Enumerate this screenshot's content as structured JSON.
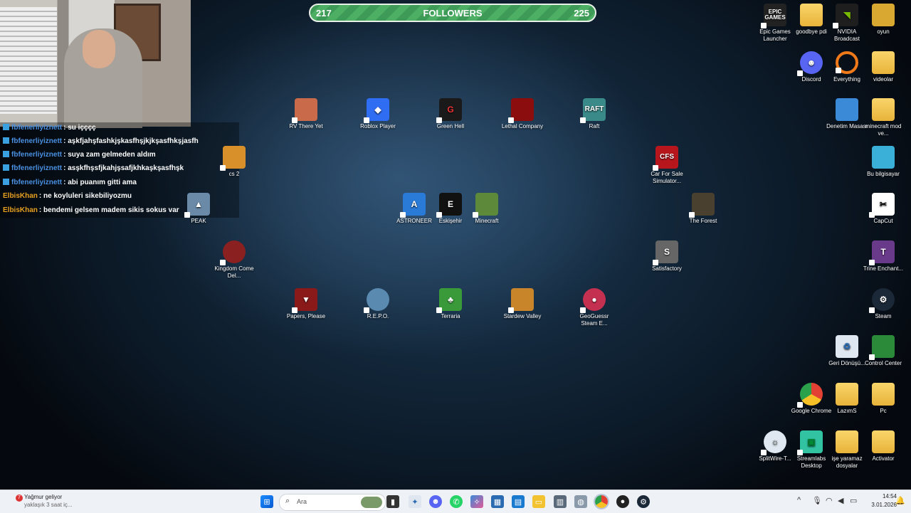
{
  "followers": {
    "current": "217",
    "label": "FOLLOWERS",
    "goal": "225",
    "progress_fraction": 0.96
  },
  "chat": [
    {
      "user": "fbfenerliyiznett",
      "text": ": su içççç",
      "color": "#4a90e2",
      "badge": true
    },
    {
      "user": "fbfenerliyiznett",
      "text": ": aşkfjahşfashkjşkasfhşjkjkşasfhkşjasfh",
      "color": "#4a90e2",
      "badge": true
    },
    {
      "user": "fbfenerliyiznett",
      "text": ": suya zam gelmeden aldım",
      "color": "#4a90e2",
      "badge": true
    },
    {
      "user": "fbfenerliyiznett",
      "text": ": asşkfhşsfjkahjşsafjkhkaşkşasfhşk",
      "color": "#4a90e2",
      "badge": true
    },
    {
      "user": "fbfenerliyiznett",
      "text": ": abi puanım gitti ama",
      "color": "#4a90e2",
      "badge": true
    },
    {
      "user": "ElbisKhan",
      "text": ": ne koyluleri sikebiliyozmu",
      "color": "#e8a020",
      "badge": false
    },
    {
      "user": "ElbisKhan",
      "text": ": bendemi gelsem madem sikis sokus var",
      "color": "#e8a020",
      "badge": false
    }
  ],
  "desktop_icons": [
    {
      "label": "RV There Yet",
      "icon": "rv-there-yet-icon",
      "color": "#c96b4a"
    },
    {
      "label": "Roblox Player",
      "icon": "roblox-icon",
      "color": "#2f6df2"
    },
    {
      "label": "Green Hell",
      "icon": "green-hell-icon",
      "color": "#1a1a1a"
    },
    {
      "label": "Lethal Company",
      "icon": "lethal-company-icon",
      "color": "#8b0d0d"
    },
    {
      "label": "Raft",
      "icon": "raft-icon",
      "color": "#3a8a8a"
    },
    {
      "label": "cs 2",
      "icon": "cs2-icon",
      "color": "#d8902a"
    },
    {
      "label": "Car For Sale Simulator...",
      "icon": "car-for-sale-icon",
      "color": "#b8161d"
    },
    {
      "label": "ASTRONEER",
      "icon": "astroneer-icon",
      "color": "#2a7bd8"
    },
    {
      "label": "Eskişehir",
      "icon": "eskisehir-icon",
      "color": "#111111"
    },
    {
      "label": "Minecraft",
      "icon": "minecraft-icon",
      "color": "#5d8a3a"
    },
    {
      "label": "The Forest",
      "icon": "the-forest-icon",
      "color": "#4a4030"
    },
    {
      "label": "PEAK",
      "icon": "peak-icon",
      "color": "#6a8aa8"
    },
    {
      "label": "Kingdom Come Del...",
      "icon": "kingdom-come-icon",
      "color": "#8a2020"
    },
    {
      "label": "Satisfactory",
      "icon": "satisfactory-icon",
      "color": "#666666"
    },
    {
      "label": "Papers, Please",
      "icon": "papers-please-icon",
      "color": "#8a1a1a"
    },
    {
      "label": "R.E.P.O.",
      "icon": "repo-icon",
      "color": "#5a8ab0"
    },
    {
      "label": "Terraria",
      "icon": "terraria-icon",
      "color": "#3a9a3a"
    },
    {
      "label": "Stardew Valley",
      "icon": "stardew-valley-icon",
      "color": "#c9852a"
    },
    {
      "label": "GeoGuessr Steam E...",
      "icon": "geoguessr-icon",
      "color": "#c43050"
    }
  ],
  "right_icons": [
    {
      "label": "Epic Games Launcher",
      "icon": "epic-games-icon",
      "color": "#222222"
    },
    {
      "label": "goodbye pdi",
      "icon": "folder-icon",
      "color": "folder"
    },
    {
      "label": "NVIDIA Broadcast",
      "icon": "nvidia-broadcast-icon",
      "color": "#1e1e1e"
    },
    {
      "label": "oyun",
      "icon": "folder-icon",
      "color": "folder"
    },
    {
      "label": "Discord",
      "icon": "discord-icon",
      "color": "#5865f2"
    },
    {
      "label": "Everything",
      "icon": "everything-icon",
      "color": "#f07a1a"
    },
    {
      "label": "videolar",
      "icon": "folder-icon",
      "color": "folder"
    },
    {
      "label": "Denetim Masası",
      "icon": "control-panel-icon",
      "color": "#3a8ad8"
    },
    {
      "label": "minecraft mod ve...",
      "icon": "folder-icon",
      "color": "folder"
    },
    {
      "label": "Bu bilgisayar",
      "icon": "this-pc-icon",
      "color": "#3ab0d8"
    },
    {
      "label": "CapCut",
      "icon": "capcut-icon",
      "color": "#ffffff"
    },
    {
      "label": "Trine Enchant...",
      "icon": "trine-icon",
      "color": "#6a3a8a"
    },
    {
      "label": "Steam",
      "icon": "steam-icon",
      "color": "#1b2838"
    },
    {
      "label": "Geri Dönüşü...",
      "icon": "recycle-bin-icon",
      "color": "#dfe8f0"
    },
    {
      "label": "Control Center",
      "icon": "control-center-icon",
      "color": "#2a8a3a"
    },
    {
      "label": "Google Chrome",
      "icon": "chrome-icon",
      "color": "#e34133"
    },
    {
      "label": "LazımS",
      "icon": "folder-icon",
      "color": "folder"
    },
    {
      "label": "Pc",
      "icon": "folder-icon",
      "color": "folder"
    },
    {
      "label": "SplitWire-T...",
      "icon": "splitwire-icon",
      "color": "#dfe8f0"
    },
    {
      "label": "Streamlabs Desktop",
      "icon": "streamlabs-icon",
      "color": "#31c3a2"
    },
    {
      "label": "işe yaramaz dosyalar",
      "icon": "folder-icon",
      "color": "folder"
    },
    {
      "label": "Activator",
      "icon": "folder-icon",
      "color": "folder"
    }
  ],
  "taskbar": {
    "weather_title": "Yağmur geliyor",
    "weather_sub": "yaklaşık 3 saat iç...",
    "weather_badge": "7",
    "search_placeholder": "Ara",
    "time": "14:54",
    "date": "3.01.2026"
  }
}
